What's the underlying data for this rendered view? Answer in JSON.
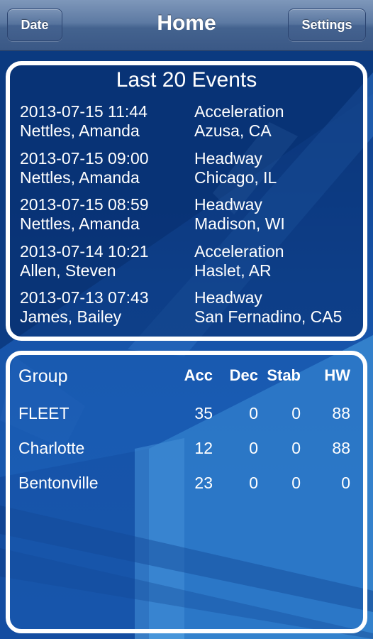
{
  "navbar": {
    "title": "Home",
    "left_button": "Date",
    "right_button": "Settings"
  },
  "events": {
    "title": "Last 20 Events",
    "items": [
      {
        "datetime": "2013-07-15 11:44",
        "name": "Nettles, Amanda",
        "type": "Acceleration",
        "location": "Azusa, CA"
      },
      {
        "datetime": "2013-07-15 09:00",
        "name": "Nettles, Amanda",
        "type": "Headway",
        "location": "Chicago, IL"
      },
      {
        "datetime": "2013-07-15 08:59",
        "name": "Nettles, Amanda",
        "type": "Headway",
        "location": "Madison, WI"
      },
      {
        "datetime": "2013-07-14 10:21",
        "name": "Allen, Steven",
        "type": "Acceleration",
        "location": "Haslet, AR"
      },
      {
        "datetime": "2013-07-13 07:43",
        "name": "James, Bailey",
        "type": "Headway",
        "location": "San Fernadino, CA5"
      }
    ]
  },
  "groups": {
    "headers": {
      "group": "Group",
      "acc": "Acc",
      "dec": "Dec",
      "stab": "Stab",
      "hw": "HW"
    },
    "rows": [
      {
        "group": "FLEET",
        "acc": "35",
        "dec": "0",
        "stab": "0",
        "hw": "88"
      },
      {
        "group": "Charlotte",
        "acc": "12",
        "dec": "0",
        "stab": "0",
        "hw": "88"
      },
      {
        "group": "Bentonville",
        "acc": "23",
        "dec": "0",
        "stab": "0",
        "hw": "0"
      }
    ]
  }
}
